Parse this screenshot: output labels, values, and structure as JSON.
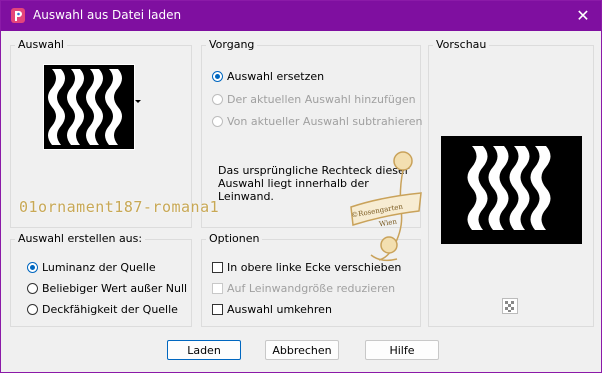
{
  "window": {
    "title": "Auswahl aus Datei laden",
    "app_icon": "paintshop-pro-icon",
    "close_glyph": "✕"
  },
  "auswahl": {
    "legend": "Auswahl",
    "thumbnail": "ornament-waves-preview"
  },
  "vorgang": {
    "legend": "Vorgang",
    "options": [
      {
        "label": "Auswahl ersetzen",
        "selected": true,
        "enabled": true
      },
      {
        "label": "Der aktuellen Auswahl hinzufügen",
        "selected": false,
        "enabled": false
      },
      {
        "label": "Von aktueller Auswahl subtrahieren",
        "selected": false,
        "enabled": false
      }
    ],
    "info_line1": "Das ursprüngliche Rechteck dieser",
    "info_line2": "Auswahl liegt innerhalb der",
    "info_line3": "Leinwand."
  },
  "vorschau": {
    "legend": "Vorschau"
  },
  "erstellen": {
    "legend": "Auswahl erstellen aus:",
    "options": [
      {
        "label": "Luminanz der Quelle",
        "selected": true
      },
      {
        "label": "Beliebiger Wert außer Null",
        "selected": false
      },
      {
        "label": "Deckfähigkeit der Quelle",
        "selected": false
      }
    ]
  },
  "optionen": {
    "legend": "Optionen",
    "checks": [
      {
        "label": "In obere linke Ecke verschieben",
        "checked": false,
        "enabled": true
      },
      {
        "label": "Auf Leinwandgröße reduzieren",
        "checked": false,
        "enabled": false
      },
      {
        "label": "Auswahl umkehren",
        "checked": false,
        "enabled": true
      }
    ]
  },
  "watermark": {
    "text": "01ornament187-romana1",
    "stamp_line1": "©Rosengarten",
    "stamp_line2": "Wien"
  },
  "buttons": {
    "ok": "Laden",
    "cancel": "Abbrechen",
    "help": "Hilfe"
  },
  "colors": {
    "titlebar": "#7f0fa0",
    "accent": "#0067c0"
  }
}
